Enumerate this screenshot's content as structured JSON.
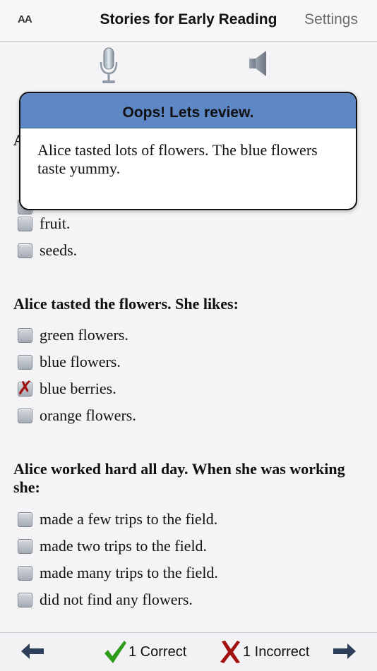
{
  "navbar": {
    "font_size_label": "AA",
    "title": "Stories for Early Reading",
    "settings_label": "Settings"
  },
  "icons": {
    "microphone": "microphone-icon",
    "speaker": "speaker-icon",
    "back": "arrow-left-icon",
    "next": "arrow-right-icon",
    "correct": "checkmark-icon",
    "incorrect": "x-mark-icon"
  },
  "colors": {
    "popup_header": "#5e87c5",
    "correct_green": "#2e9b1a",
    "incorrect_red": "#a31010",
    "arrow_navy": "#2c3e5a"
  },
  "popup": {
    "title": "Oops! Lets review.",
    "text": "Alice tasted lots of flowers. The blue flowers taste yummy."
  },
  "quiz": {
    "q1_partial": {
      "options": [
        {
          "label": "fruit.",
          "state": "unchecked"
        },
        {
          "label": "seeds.",
          "state": "unchecked"
        }
      ]
    },
    "q2": {
      "question": "Alice tasted the flowers. She likes:",
      "options": [
        {
          "label": "green flowers.",
          "state": "unchecked"
        },
        {
          "label": "blue flowers.",
          "state": "unchecked"
        },
        {
          "label": "blue berries.",
          "state": "incorrect"
        },
        {
          "label": "orange flowers.",
          "state": "unchecked"
        }
      ]
    },
    "q3": {
      "question": "Alice worked hard all day. When she was working she:",
      "options": [
        {
          "label": "made a few trips to the field.",
          "state": "unchecked"
        },
        {
          "label": "made two trips to the field.",
          "state": "unchecked"
        },
        {
          "label": "made many trips to the field.",
          "state": "unchecked"
        },
        {
          "label": "did not find any flowers.",
          "state": "unchecked"
        }
      ]
    }
  },
  "footer": {
    "correct_label": "1 Correct",
    "incorrect_label": "1 Incorrect"
  }
}
